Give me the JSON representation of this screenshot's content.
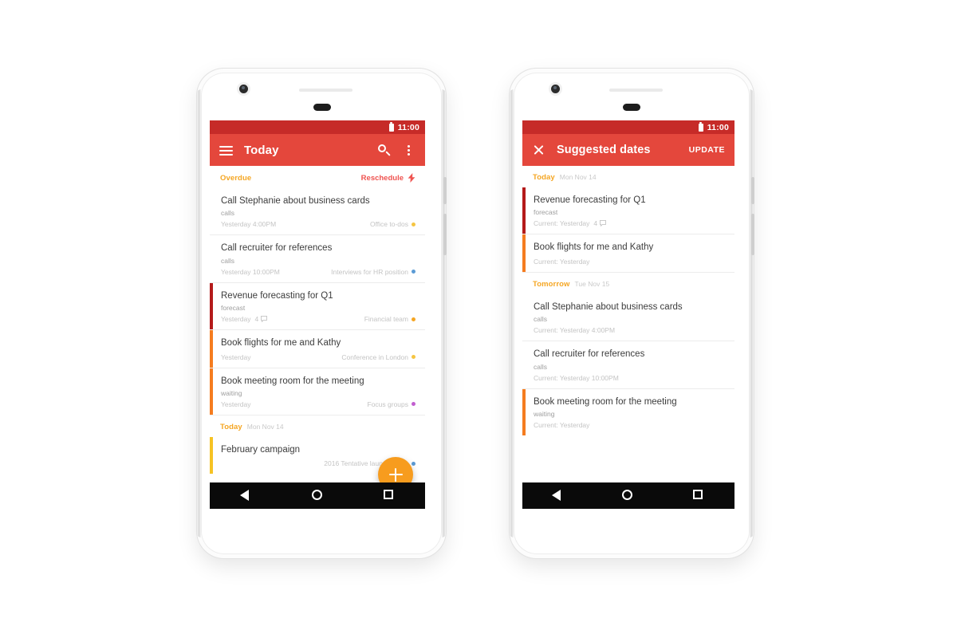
{
  "colors": {
    "status_bar": "#c62b28",
    "app_bar": "#e4473c",
    "accent_orange": "#f5a623",
    "fab": "#f79c1e",
    "priority_high": "#b41a1a",
    "priority_medium": "#f57c1f",
    "priority_low": "#f6c324",
    "reschedule": "#ef5350"
  },
  "phone_left": {
    "status": {
      "time": "11:00",
      "battery_icon": "battery-icon"
    },
    "appbar": {
      "menu_icon": "hamburger-menu-icon",
      "title": "Today",
      "search_icon": "search-icon",
      "more_icon": "overflow-menu-icon"
    },
    "sections": [
      {
        "label": "Overdue",
        "date": "",
        "action_label": "Reschedule",
        "action_icon": "lightning-bolt-icon",
        "tasks": [
          {
            "title": "Call Stephanie about business cards",
            "subtitle": "calls",
            "when": "Yesterday 4:00PM",
            "comments": "",
            "tag": "Office to-dos",
            "tag_color": "#f5c542",
            "priority_color": ""
          },
          {
            "title": "Call recruiter for references",
            "subtitle": "calls",
            "when": "Yesterday 10:00PM",
            "comments": "",
            "tag": "Interviews for HR position",
            "tag_color": "#5b9bd5",
            "priority_color": ""
          },
          {
            "title": "Revenue forecasting for Q1",
            "subtitle": "forecast",
            "when": "Yesterday",
            "comments": "4",
            "tag": "Financial team",
            "tag_color": "#f5a623",
            "priority_color": "#b41a1a"
          },
          {
            "title": "Book flights for me and Kathy",
            "subtitle": "",
            "when": "Yesterday",
            "comments": "",
            "tag": "Conference in London",
            "tag_color": "#f5c542",
            "priority_color": "#f57c1f"
          },
          {
            "title": "Book meeting room for the meeting",
            "subtitle": "waiting",
            "when": "Yesterday",
            "comments": "",
            "tag": "Focus groups",
            "tag_color": "#c25fd0",
            "priority_color": "#f57c1f"
          }
        ]
      },
      {
        "label": "Today",
        "date": "Mon Nov 14",
        "action_label": "",
        "action_icon": "",
        "tasks": [
          {
            "title": "February campaign",
            "subtitle": "",
            "when": "",
            "comments": "",
            "tag": "2016 Tentative launch dates",
            "tag_color": "#5b9bd5",
            "priority_color": "#f6c324"
          }
        ]
      }
    ],
    "fab": {
      "icon": "plus-icon",
      "label": "Add task"
    },
    "navbar": {
      "back_icon": "nav-back-icon",
      "home_icon": "nav-home-icon",
      "recents_icon": "nav-recents-icon"
    }
  },
  "phone_right": {
    "status": {
      "time": "11:00",
      "battery_icon": "battery-icon"
    },
    "appbar": {
      "close_icon": "close-icon",
      "title": "Suggested dates",
      "update_label": "UPDATE"
    },
    "sections": [
      {
        "label": "Today",
        "date": "Mon Nov 14",
        "tasks": [
          {
            "title": "Revenue forecasting for Q1",
            "subtitle": "forecast",
            "when": "Current: Yesterday",
            "comments": "4",
            "priority_color": "#b41a1a"
          },
          {
            "title": "Book flights for me and Kathy",
            "subtitle": "",
            "when": "Current: Yesterday",
            "comments": "",
            "priority_color": "#f57c1f"
          }
        ]
      },
      {
        "label": "Tomorrow",
        "date": "Tue Nov 15",
        "tasks": [
          {
            "title": "Call Stephanie about business cards",
            "subtitle": "calls",
            "when": "Current: Yesterday 4:00PM",
            "comments": "",
            "priority_color": ""
          },
          {
            "title": "Call recruiter for references",
            "subtitle": "calls",
            "when": "Current: Yesterday 10:00PM",
            "comments": "",
            "priority_color": ""
          },
          {
            "title": "Book meeting room for the meeting",
            "subtitle": "waiting",
            "when": "Current: Yesterday",
            "comments": "",
            "priority_color": "#f57c1f"
          }
        ]
      }
    ],
    "navbar": {
      "back_icon": "nav-back-icon",
      "home_icon": "nav-home-icon",
      "recents_icon": "nav-recents-icon"
    }
  }
}
